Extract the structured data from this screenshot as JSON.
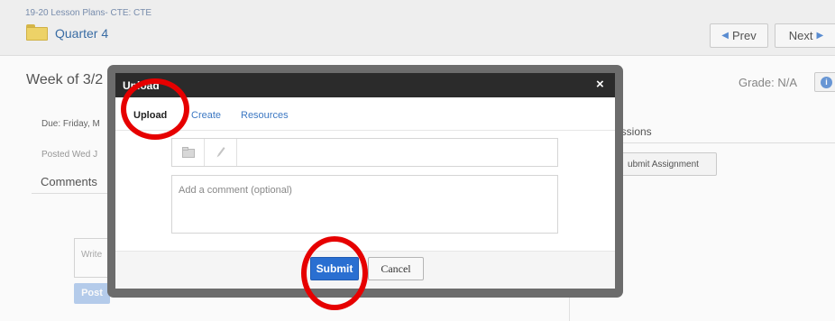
{
  "header": {
    "breadcrumb": "19-20 Lesson Plans- CTE: CTE",
    "folder_icon": "folder-icon",
    "course_title": "Quarter 4",
    "prev_label": "Prev",
    "next_label": "Next"
  },
  "assignment": {
    "title": "Week of 3/2",
    "grade_label": "Grade: N/A",
    "due_text": "Due: Friday, M",
    "posted_text": "Posted Wed J",
    "comments_heading": "Comments",
    "comment_placeholder": "Write",
    "post_label": "Post",
    "submissions_heading": "issions",
    "submit_assignment_label": "ubmit Assignment"
  },
  "modal": {
    "title": "Upload",
    "close_glyph": "×",
    "tabs": [
      {
        "label": "Upload",
        "active": true
      },
      {
        "label": "Create",
        "active": false
      },
      {
        "label": "Resources",
        "active": false
      }
    ],
    "file_icons": [
      "folder-icon",
      "attach-icon"
    ],
    "comment_placeholder": "Add a comment (optional)",
    "submit_label": "Submit",
    "cancel_label": "Cancel"
  },
  "colors": {
    "accent": "#2a6fd1",
    "link": "#3c78c3",
    "annotation": "#e60000"
  }
}
